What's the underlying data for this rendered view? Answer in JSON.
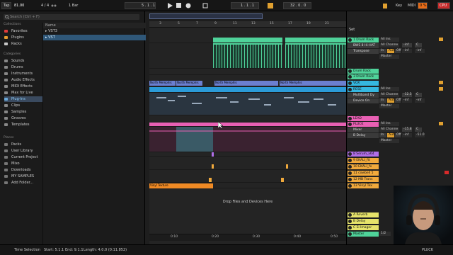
{
  "transport": {
    "tap": "Tap",
    "tempo": "81.00",
    "time_sig": "4 / 4",
    "quantize": "1 Bar",
    "position": "5 . 1 . 1",
    "loop_start": "1 . 1 . 1",
    "loop_length": "32 . 0 . 0",
    "key": "Key",
    "midi": "MIDI",
    "cpu": "0 %",
    "disk": "CPU"
  },
  "browser": {
    "search_placeholder": "Search (Ctrl + F)",
    "collections_label": "Collections",
    "collections": [
      {
        "label": "Favorites",
        "color": "#e23b3b"
      },
      {
        "label": "Plugins",
        "color": "#e69b2f"
      },
      {
        "label": "Racks",
        "color": "#c8c8c8"
      }
    ],
    "categories_label": "Categories",
    "categories": [
      {
        "label": "Sounds",
        "icon": "sounds-icon"
      },
      {
        "label": "Drums",
        "icon": "drums-icon"
      },
      {
        "label": "Instruments",
        "icon": "instruments-icon"
      },
      {
        "label": "Audio Effects",
        "icon": "audio-effects-icon"
      },
      {
        "label": "MIDI Effects",
        "icon": "midi-effects-icon"
      },
      {
        "label": "Max for Live",
        "icon": "max-icon"
      },
      {
        "label": "Plug-Ins",
        "icon": "plugins-icon",
        "selected": true
      },
      {
        "label": "Clips",
        "icon": "clips-icon"
      },
      {
        "label": "Samples",
        "icon": "samples-icon"
      },
      {
        "label": "Grooves",
        "icon": "grooves-icon"
      },
      {
        "label": "Templates",
        "icon": "templates-icon"
      }
    ],
    "places_label": "Places",
    "places": [
      {
        "label": "Packs"
      },
      {
        "label": "User Library"
      },
      {
        "label": "Current Project"
      },
      {
        "label": "Mixo"
      },
      {
        "label": "Downloads"
      },
      {
        "label": "MY SAMPLES"
      },
      {
        "label": "Add Folder..."
      }
    ],
    "column_header": "Name",
    "files": [
      {
        "label": "▸ VST3",
        "selected": false
      },
      {
        "label": "▸ VST",
        "selected": true
      }
    ]
  },
  "arrangement": {
    "ruler_ticks": [
      "3",
      "5",
      "7",
      "9",
      "11",
      "13",
      "15",
      "17",
      "19",
      "21"
    ],
    "clip_north": "North Memphis",
    "clip_vinyl": "Vinyl Texture",
    "drop_text": "Drop Files and Devices Here",
    "time_ticks": [
      "0:10",
      "0:20",
      "0:30",
      "0:40",
      "0:50"
    ],
    "set_label": "Set"
  },
  "tracks": [
    {
      "name": "1 Drum Rack",
      "color": "#4fd39a"
    },
    {
      "name": "BWS 8 Hi-HAT",
      "color": "#4fd39a"
    },
    {
      "name": "Transpose",
      "color": "#4fd39a"
    },
    {
      "name": "Drum Rack",
      "color": "#4fd39a"
    },
    {
      "name": "3 Drum Rack",
      "color": "#4fd39a"
    },
    {
      "name": "VOX",
      "color": "#35b7e0"
    },
    {
      "name": "RESE",
      "color": "#35b7e0"
    },
    {
      "name": "Multiband Dy",
      "color": "#35b7e0"
    },
    {
      "name": "Device On",
      "color": "#35b7e0"
    },
    {
      "name": "LEAD",
      "color": "#e960b4"
    },
    {
      "name": "PLUCK",
      "color": "#e960b4"
    },
    {
      "name": "Mixer",
      "color": "#e960b4"
    },
    {
      "name": "B Delay",
      "color": "#e960b4"
    },
    {
      "name": "8 Serum_x64",
      "color": "#b06ee8"
    },
    {
      "name": "9 EKALI_fit",
      "color": "#f0a93c"
    },
    {
      "name": "10 EKALI_fx",
      "color": "#f0a93c"
    },
    {
      "name": "11 cowbell 5",
      "color": "#f0a93c"
    },
    {
      "name": "12 MB Trans",
      "color": "#f0a93c"
    },
    {
      "name": "13 Vinyl Tex",
      "color": "#f0a93c"
    }
  ],
  "returns": [
    {
      "name": "A Reverb",
      "color": "#e6e36a"
    },
    {
      "name": "B Delay",
      "color": "#e6e36a"
    },
    {
      "name": "C Ei Imager",
      "color": "#e6e36a"
    },
    {
      "name": "Master",
      "color": "#4fd39a"
    }
  ],
  "io": {
    "all_ins": "All Ins",
    "all_channels": "All Channe",
    "in": "In",
    "auto": "Auto",
    "off": "Off",
    "master": "Master",
    "inf": "-inf",
    "c": "C",
    "vol1": "-12.5",
    "vol2": "-15.8",
    "vol3": "-51.0",
    "master_sel": "1/2"
  },
  "status": {
    "time_selection": "Time Selection",
    "start": "Start: 5.1.1",
    "end": "End: 9.1.1",
    "length": "Length: 4.0.0 (0:11.852)",
    "track": "PLUCK"
  }
}
